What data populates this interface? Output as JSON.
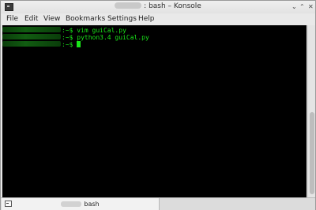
{
  "window": {
    "title": ": bash – Konsole",
    "minimize_glyph": "⌄",
    "maximize_glyph": "⌃",
    "close_glyph": "✕"
  },
  "menu": [
    "File",
    "Edit",
    "View",
    "Bookmarks",
    "Settings",
    "Help"
  ],
  "terminal": {
    "lines": [
      {
        "prompt": ":~$ ",
        "command": "vim guiCal.py"
      },
      {
        "prompt": ":~$ ",
        "command": "python3.4 guiCal.py"
      },
      {
        "prompt": ":~$ ",
        "command": ""
      }
    ]
  },
  "tab": {
    "label": "bash"
  },
  "colors": {
    "terminal_bg": "#000000",
    "terminal_fg": "#19e619"
  }
}
